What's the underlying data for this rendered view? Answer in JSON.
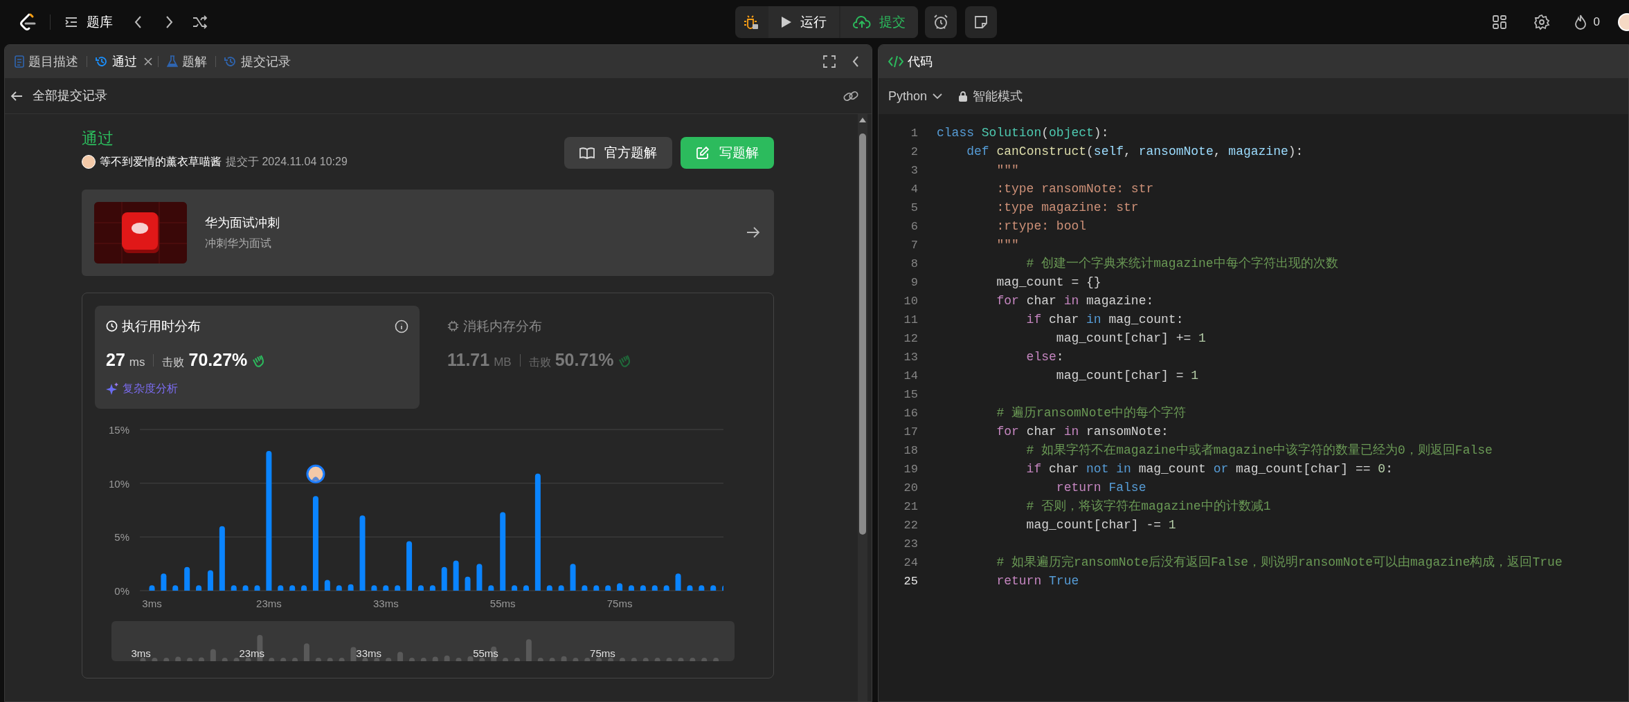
{
  "top_bar": {
    "nav_label": "题库",
    "actions": [
      {
        "label": "运行",
        "kind": "run"
      },
      {
        "label": "提交",
        "kind": "submit"
      }
    ],
    "streak": "0"
  },
  "left_panel": {
    "tabs": [
      {
        "label": "题目描述",
        "kind": "description",
        "selected": false,
        "closable": false
      },
      {
        "label": "通过",
        "kind": "result",
        "selected": true,
        "closable": true
      },
      {
        "label": "题解",
        "kind": "solution",
        "selected": false,
        "closable": false
      },
      {
        "label": "提交记录",
        "kind": "history",
        "selected": false,
        "closable": false
      }
    ],
    "back_label": "全部提交记录",
    "submission": {
      "status": "通过",
      "user": "等不到爱情的薰衣草喵酱",
      "submitted": "提交于 2024.11.04 10:29",
      "buttons": [
        {
          "label": "官方题解",
          "kind": "secondary"
        },
        {
          "label": "写题解",
          "kind": "primary"
        }
      ]
    },
    "promo": {
      "title": "华为面试冲刺",
      "subtitle": "冲刺华为面试"
    },
    "stats": [
      {
        "kind": "runtime",
        "title": "执行用时分布",
        "value": "27",
        "unit": "ms",
        "beat_label": "击败",
        "beat": "70.27%",
        "selected": true
      },
      {
        "kind": "memory",
        "title": "消耗内存分布",
        "value": "11.71",
        "unit": "MB",
        "beat_label": "击败",
        "beat": "50.71%",
        "selected": false
      }
    ],
    "analysis_link": "复杂度分析",
    "chart_data": {
      "type": "bar",
      "ylim": [
        0,
        15
      ],
      "yticks": [
        {
          "value": 0,
          "label": "0%"
        },
        {
          "value": 5,
          "label": "5%"
        },
        {
          "value": 10,
          "label": "10%"
        },
        {
          "value": 15,
          "label": "15%"
        }
      ],
      "categories": [
        "3ms",
        null,
        null,
        null,
        null,
        null,
        null,
        null,
        null,
        null,
        "23ms",
        null,
        null,
        null,
        null,
        null,
        null,
        null,
        null,
        null,
        "33ms",
        null,
        null,
        null,
        null,
        null,
        null,
        null,
        null,
        null,
        "55ms",
        null,
        null,
        null,
        null,
        null,
        null,
        null,
        null,
        null,
        "75ms",
        null,
        null,
        null,
        null,
        null,
        null,
        null,
        null,
        null
      ],
      "series": [
        {
          "color": "#0a84ff",
          "values": [
            0.5,
            1.6,
            0.5,
            2.2,
            0.5,
            1.9,
            6,
            0.5,
            0.5,
            0.5,
            13,
            0.5,
            0.5,
            0.5,
            8.8,
            1,
            0.5,
            0.6,
            7,
            0.5,
            0.5,
            0.5,
            4.6,
            0.5,
            0.5,
            2.2,
            2.8,
            1.3,
            2.5,
            0.5,
            7.3,
            0.5,
            0.5,
            10.9,
            0.5,
            0.5,
            2.5,
            0.5,
            0.5,
            0.5,
            0.7,
            0.5,
            0.5,
            0.5,
            0.5,
            1.6,
            0.5,
            0.5,
            0.5,
            0.5
          ]
        }
      ]
    },
    "overview": {
      "labels": [
        "3ms",
        "23ms",
        "33ms",
        "55ms",
        "75ms"
      ]
    }
  },
  "editor": {
    "title": "代码",
    "language": "Python",
    "mode": "智能模式",
    "lines": [
      {
        "n": "1",
        "current": false,
        "tokens": [
          {
            "kind": "keyword",
            "text": "class "
          },
          {
            "kind": "type",
            "text": "Solution"
          },
          {
            "kind": "plain",
            "text": "("
          },
          {
            "kind": "type",
            "text": "object"
          },
          {
            "kind": "plain",
            "text": "):"
          }
        ]
      },
      {
        "n": "2",
        "current": false,
        "tokens": [
          {
            "kind": "keyword",
            "text": "    def "
          },
          {
            "kind": "function",
            "text": "canConstruct"
          },
          {
            "kind": "plain",
            "text": "("
          },
          {
            "kind": "param",
            "text": "self"
          },
          {
            "kind": "plain",
            "text": ", "
          },
          {
            "kind": "param",
            "text": "ransomNote"
          },
          {
            "kind": "plain",
            "text": ", "
          },
          {
            "kind": "param",
            "text": "magazine"
          },
          {
            "kind": "plain",
            "text": "):"
          }
        ]
      },
      {
        "n": "3",
        "current": false,
        "tokens": [
          {
            "kind": "string",
            "text": "        \"\"\""
          }
        ]
      },
      {
        "n": "4",
        "current": false,
        "tokens": [
          {
            "kind": "string",
            "text": "        :type ransomNote: str"
          }
        ]
      },
      {
        "n": "5",
        "current": false,
        "tokens": [
          {
            "kind": "string",
            "text": "        :type magazine: str"
          }
        ]
      },
      {
        "n": "6",
        "current": false,
        "tokens": [
          {
            "kind": "string",
            "text": "        :rtype: bool"
          }
        ]
      },
      {
        "n": "7",
        "current": false,
        "tokens": [
          {
            "kind": "string",
            "text": "        \"\"\""
          }
        ]
      },
      {
        "n": "8",
        "current": false,
        "tokens": [
          {
            "kind": "comment",
            "text": "            # 创建一个字典来统计magazine中每个字符出现的次数"
          }
        ]
      },
      {
        "n": "9",
        "current": false,
        "tokens": [
          {
            "kind": "plain",
            "text": "        mag_count = {}"
          }
        ]
      },
      {
        "n": "10",
        "current": false,
        "tokens": [
          {
            "kind": "control",
            "text": "        for"
          },
          {
            "kind": "plain",
            "text": " char "
          },
          {
            "kind": "control",
            "text": "in"
          },
          {
            "kind": "plain",
            "text": " magazine:"
          }
        ]
      },
      {
        "n": "11",
        "current": false,
        "tokens": [
          {
            "kind": "control",
            "text": "            if"
          },
          {
            "kind": "plain",
            "text": " char "
          },
          {
            "kind": "keyword",
            "text": "in"
          },
          {
            "kind": "plain",
            "text": " mag_count:"
          }
        ]
      },
      {
        "n": "12",
        "current": false,
        "tokens": [
          {
            "kind": "plain",
            "text": "                mag_count[char] += "
          },
          {
            "kind": "number",
            "text": "1"
          }
        ]
      },
      {
        "n": "13",
        "current": false,
        "tokens": [
          {
            "kind": "control",
            "text": "            else"
          },
          {
            "kind": "plain",
            "text": ":"
          }
        ]
      },
      {
        "n": "14",
        "current": false,
        "tokens": [
          {
            "kind": "plain",
            "text": "                mag_count[char] = "
          },
          {
            "kind": "number",
            "text": "1"
          }
        ]
      },
      {
        "n": "15",
        "current": false
      },
      {
        "n": "16",
        "current": false,
        "tokens": [
          {
            "kind": "comment",
            "text": "        # 遍历ransomNote中的每个字符"
          }
        ]
      },
      {
        "n": "17",
        "current": false,
        "tokens": [
          {
            "kind": "control",
            "text": "        for"
          },
          {
            "kind": "plain",
            "text": " char "
          },
          {
            "kind": "control",
            "text": "in"
          },
          {
            "kind": "plain",
            "text": " ransomNote:"
          }
        ]
      },
      {
        "n": "18",
        "current": false,
        "tokens": [
          {
            "kind": "comment",
            "text": "            # 如果字符不在magazine中或者magazine中该字符的数量已经为0，则返回False"
          }
        ]
      },
      {
        "n": "19",
        "current": false,
        "tokens": [
          {
            "kind": "control",
            "text": "            if"
          },
          {
            "kind": "plain",
            "text": " char "
          },
          {
            "kind": "keyword",
            "text": "not in"
          },
          {
            "kind": "plain",
            "text": " mag_count "
          },
          {
            "kind": "keyword",
            "text": "or"
          },
          {
            "kind": "plain",
            "text": " mag_count[char] == "
          },
          {
            "kind": "number",
            "text": "0"
          },
          {
            "kind": "plain",
            "text": ":"
          }
        ]
      },
      {
        "n": "20",
        "current": false,
        "tokens": [
          {
            "kind": "control",
            "text": "                return"
          },
          {
            "kind": "keyword",
            "text": " False"
          }
        ]
      },
      {
        "n": "21",
        "current": false,
        "tokens": [
          {
            "kind": "comment",
            "text": "            # 否则，将该字符在magazine中的计数减1"
          }
        ]
      },
      {
        "n": "22",
        "current": false,
        "tokens": [
          {
            "kind": "plain",
            "text": "            mag_count[char] -= "
          },
          {
            "kind": "number",
            "text": "1"
          }
        ]
      },
      {
        "n": "23",
        "current": false
      },
      {
        "n": "24",
        "current": false,
        "tokens": [
          {
            "kind": "comment",
            "text": "        # 如果遍历完ransomNote后没有返回False，则说明ransomNote可以由magazine构成，返回True"
          }
        ]
      },
      {
        "n": "25",
        "current": true,
        "tokens": [
          {
            "kind": "control",
            "text": "        return"
          },
          {
            "kind": "keyword",
            "text": " True"
          }
        ]
      }
    ]
  }
}
